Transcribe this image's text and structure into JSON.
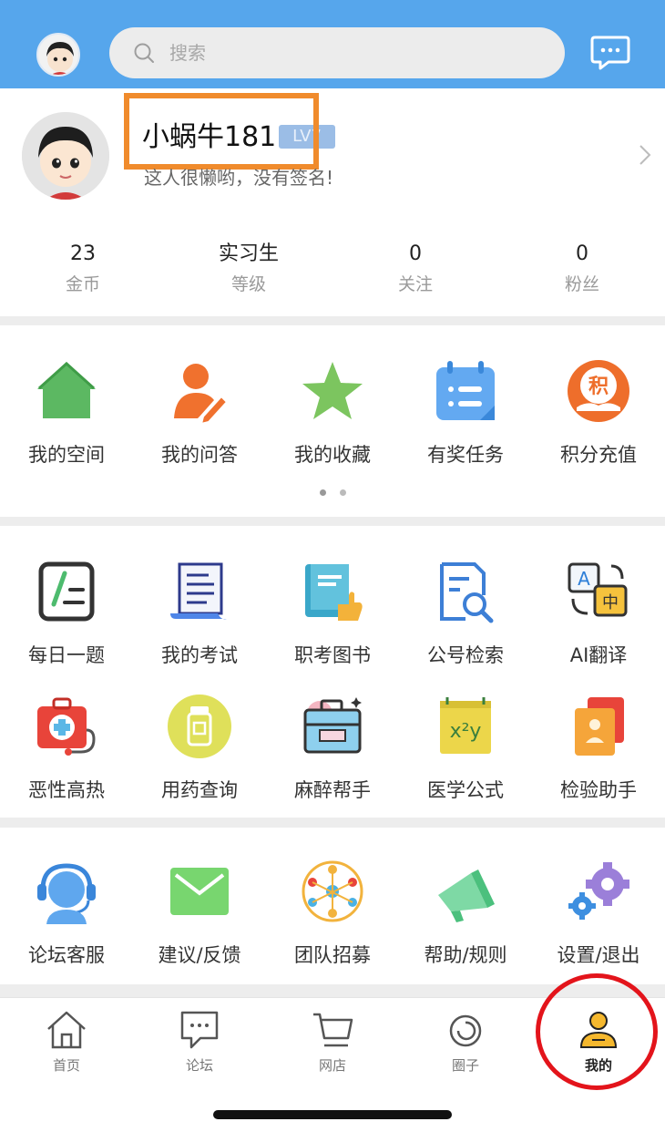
{
  "search": {
    "placeholder": "搜索"
  },
  "profile": {
    "username": "小蜗牛181",
    "level_badge": "LV7",
    "signature": "这人很懒哟，没有签名!",
    "stats": [
      {
        "value": "23",
        "label": "金币"
      },
      {
        "value": "实习生",
        "label": "等级"
      },
      {
        "value": "0",
        "label": "关注"
      },
      {
        "value": "0",
        "label": "粉丝"
      }
    ]
  },
  "section1": {
    "items": [
      {
        "label": "我的空间",
        "icon": "house-icon"
      },
      {
        "label": "我的问答",
        "icon": "user-edit-icon"
      },
      {
        "label": "我的收藏",
        "icon": "star-icon"
      },
      {
        "label": "有奖任务",
        "icon": "calendar-task-icon"
      },
      {
        "label": "积分充值",
        "icon": "points-icon"
      }
    ],
    "points_glyph": "积",
    "page_count": 2,
    "active_page": 1
  },
  "section2": {
    "items": [
      {
        "label": "每日一题",
        "icon": "daily-question-icon"
      },
      {
        "label": "我的考试",
        "icon": "exam-paper-icon"
      },
      {
        "label": "职考图书",
        "icon": "book-icon"
      },
      {
        "label": "公号检索",
        "icon": "document-search-icon"
      },
      {
        "label": "AI翻译",
        "icon": "translate-icon"
      },
      {
        "label": "恶性高热",
        "icon": "medical-kit-icon"
      },
      {
        "label": "用药查询",
        "icon": "medicine-bottle-icon"
      },
      {
        "label": "麻醉帮手",
        "icon": "anesthesia-case-icon"
      },
      {
        "label": "医学公式",
        "icon": "formula-icon"
      },
      {
        "label": "检验助手",
        "icon": "lab-report-icon"
      }
    ],
    "translate_glyphs": {
      "a": "A",
      "b": "中"
    },
    "formula_glyph": "x²y"
  },
  "section3": {
    "items": [
      {
        "label": "论坛客服",
        "icon": "customer-service-icon"
      },
      {
        "label": "建议/反馈",
        "icon": "mail-icon"
      },
      {
        "label": "团队招募",
        "icon": "team-icon"
      },
      {
        "label": "帮助/规则",
        "icon": "megaphone-icon"
      },
      {
        "label": "设置/退出",
        "icon": "settings-gears-icon"
      }
    ]
  },
  "tabs": [
    {
      "label": "首页",
      "icon": "home-tab-icon"
    },
    {
      "label": "论坛",
      "icon": "forum-tab-icon"
    },
    {
      "label": "网店",
      "icon": "cart-tab-icon"
    },
    {
      "label": "圈子",
      "icon": "circle-tab-icon"
    },
    {
      "label": "我的",
      "icon": "me-tab-icon",
      "active": true
    }
  ],
  "colors": {
    "header_blue": "#56a6ec",
    "highlight_orange": "#f08b2c",
    "annotation_red": "#e3141b",
    "active_tab_yellow": "#f5b82e"
  }
}
